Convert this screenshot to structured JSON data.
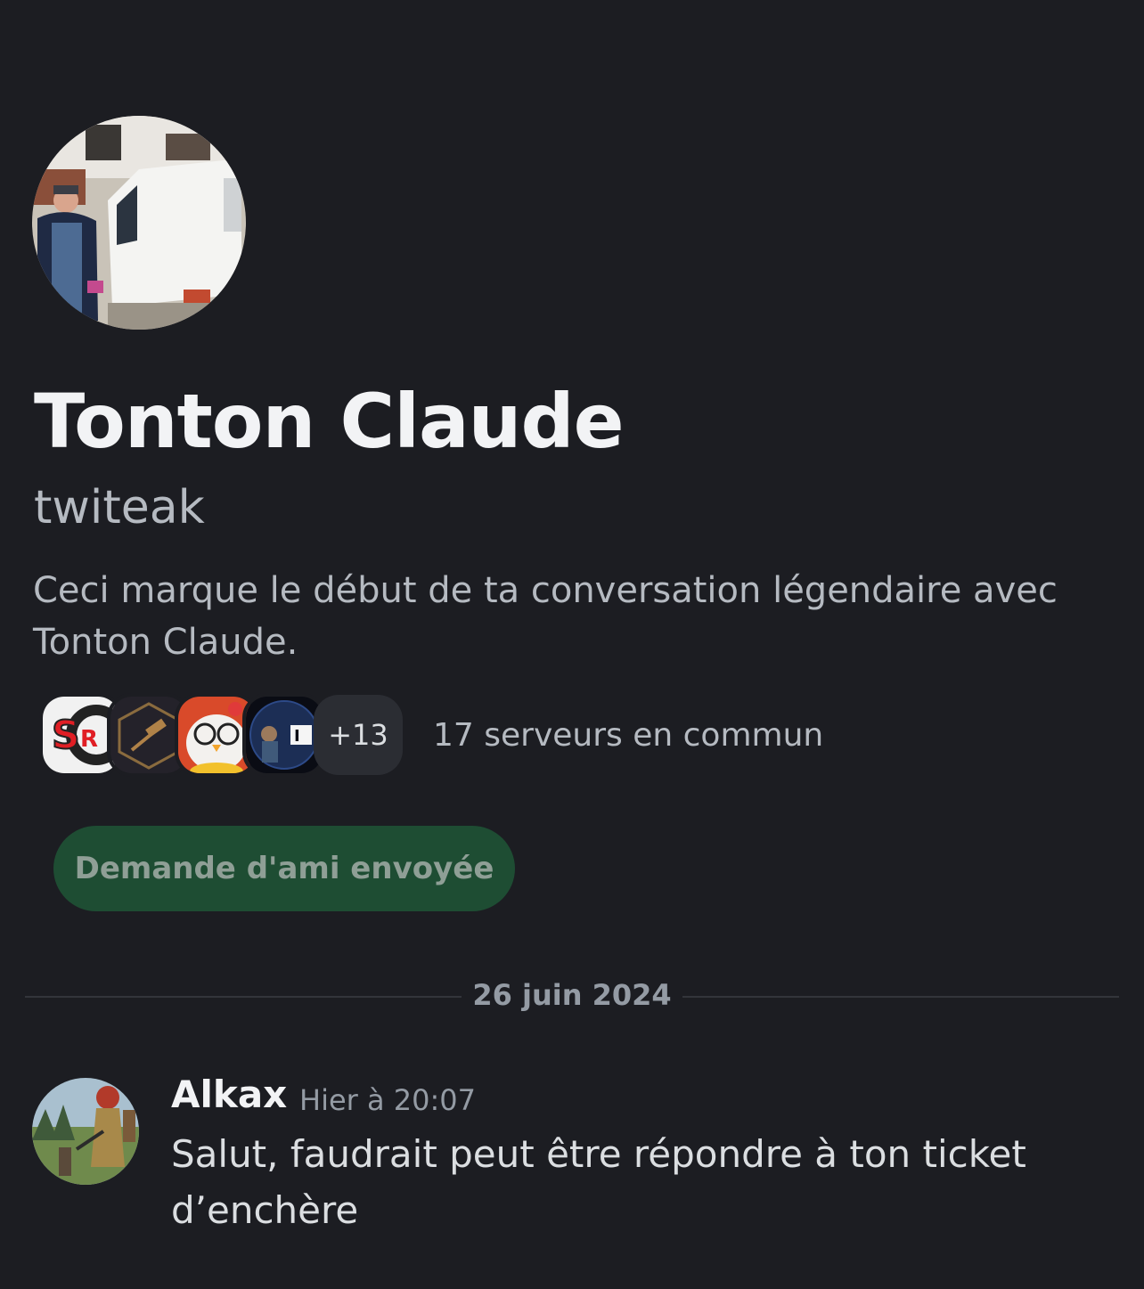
{
  "profile": {
    "display_name": "Tonton Claude",
    "username": "twiteak",
    "intro": "Ceci marque le début de ta conversation légendaire avec Tonton Claude."
  },
  "mutual_servers": {
    "more_count": "+13",
    "label": "17 serveurs en commun"
  },
  "friend_button": {
    "label": "Demande d'ami envoyée"
  },
  "divider": {
    "date": "26 juin 2024"
  },
  "message": {
    "author": "Alkax",
    "time": "Hier à 20:07",
    "text": "Salut, faudrait peut être répondre à ton ticket d’enchère"
  },
  "colors": {
    "background": "#1c1d22",
    "button_green": "#1e4d33",
    "divider": "#33353b"
  }
}
